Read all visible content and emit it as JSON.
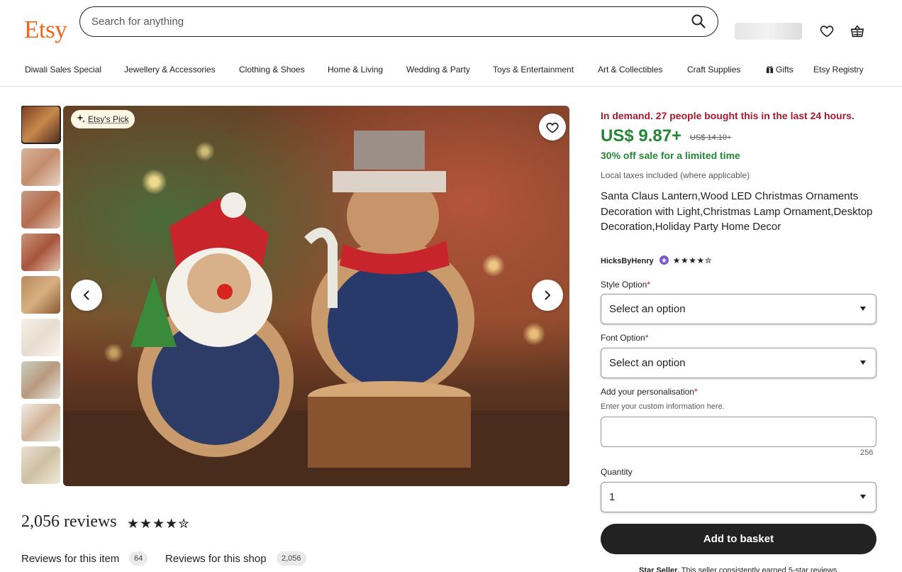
{
  "header": {
    "logo": "Etsy",
    "search_placeholder": "Search for anything"
  },
  "nav": {
    "items": [
      "Diwali Sales Special",
      "Jewellery & Accessories",
      "Clothing & Shoes",
      "Home & Living",
      "Wedding & Party",
      "Toys & Entertainment",
      "Art & Collectibles",
      "Craft Supplies",
      "Gifts",
      "Etsy Registry"
    ]
  },
  "gallery": {
    "badge": "Etsy's Pick",
    "thumbnail_count": 9
  },
  "reviews": {
    "count_label": "2,056 reviews",
    "stars": "★★★★✮",
    "tab_item_label": "Reviews for this item",
    "tab_item_count": "64",
    "tab_shop_label": "Reviews for this shop",
    "tab_shop_count": "2,056"
  },
  "listing": {
    "demand": "In demand. 27 people bought this in the last 24 hours.",
    "price": "US$ 9.87+",
    "old_price": "US$ 14.10+",
    "sale": "30% off sale for a limited time",
    "tax": "Local taxes included (where applicable)",
    "title": "Santa Claus Lantern,Wood LED Christmas Ornaments Decoration with Light,Christmas Lamp Ornament,Desktop Decoration,Holiday Party Home Decor",
    "shop_name": "HicksByHenry",
    "shop_stars": "★★★★✮"
  },
  "options": {
    "style_label": "Style Option",
    "style_value": "Select an option",
    "font_label": "Font Option",
    "font_value": "Select an option",
    "personalisation_label": "Add your personalisation",
    "personalisation_hint": "Enter your custom information here.",
    "char_limit": "256",
    "quantity_label": "Quantity",
    "quantity_value": "1",
    "required_mark": "*"
  },
  "actions": {
    "add_to_basket": "Add to basket",
    "star_seller_title": "Star Seller.",
    "star_seller_text": " This seller consistently earned 5-star reviews"
  },
  "colors": {
    "brand": "#F1641E",
    "sale_green": "#258635",
    "demand_red": "#A61A2E"
  }
}
